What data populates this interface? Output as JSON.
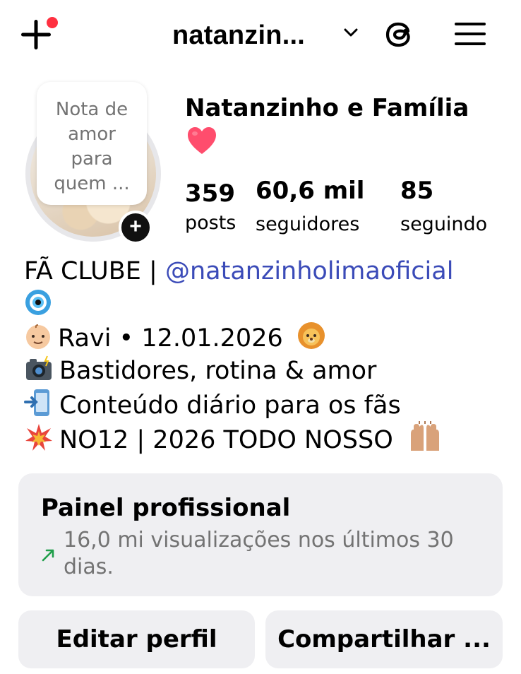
{
  "header": {
    "username": "natanzin...",
    "create_icon": "plus-icon",
    "dropdown_icon": "chevron-down-icon",
    "threads_icon": "threads-icon",
    "menu_icon": "hamburger-menu-icon",
    "notification_color": "#ff3040"
  },
  "profile": {
    "note": "Nota de amor para quem ...",
    "display_name": "Natanzinho e Família",
    "name_emoji": "red-heart-icon",
    "stats": [
      {
        "value": "359",
        "label": "posts"
      },
      {
        "value": "60,6 mil",
        "label": "seguidores"
      },
      {
        "value": "85",
        "label": "seguindo"
      }
    ]
  },
  "bio": {
    "line1_text": "FÃ CLUBE | ",
    "line1_mention": "@natanzinholimaoficial",
    "line2_emoji": "nazar-amulet-icon",
    "line3": "Ravi • 12.01.2026",
    "line3_emoji_start": "baby-icon",
    "line3_emoji_end": "lion-icon",
    "line4": "Bastidores, rotina & amor",
    "line4_emoji": "camera-flash-icon",
    "line5": "Conteúdo diário para os fãs",
    "line5_emoji": "mobile-arrow-icon",
    "line6": "NO12 | 2026 TODO NOSSO",
    "line6_emoji_start": "collision-icon",
    "line6_emoji_end": "raising-hands-icon"
  },
  "dashboard": {
    "title": "Painel profissional",
    "subtitle": "16,0 mi visualizações nos últimos 30 dias.",
    "trend_icon": "trend-up-arrow-icon",
    "trend_color": "#1f9e4a"
  },
  "actions": {
    "edit_label": "Editar perfil",
    "share_label": "Compartilhar ..."
  },
  "colors": {
    "mention": "#3b4bb8",
    "card_bg": "#efeff2",
    "secondary_text": "#737373"
  }
}
